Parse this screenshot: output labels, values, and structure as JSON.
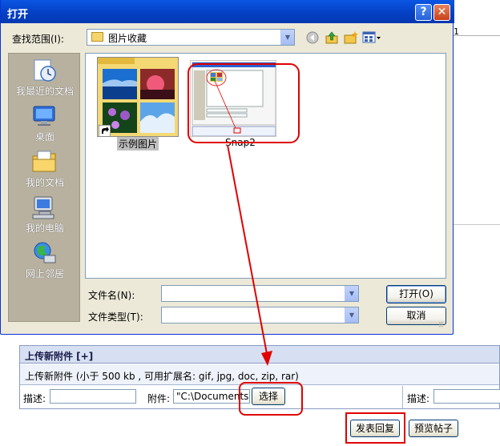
{
  "dialog": {
    "title": "打开",
    "help_glyph": "?",
    "close_glyph": "✕",
    "lookin_label": "查找范围(I):",
    "lookin_value": "图片收藏",
    "filename_label": "文件名(N):",
    "filename_value": "",
    "filetype_label": "文件类型(T):",
    "filetype_value": "",
    "open_label": "打开(O)",
    "cancel_label": "取消",
    "toolbar_icons": [
      "back-icon",
      "up-folder-icon",
      "new-folder-icon",
      "view-menu-icon"
    ],
    "places": [
      {
        "label": "我最近的文档",
        "icon": "recent-documents-icon"
      },
      {
        "label": "桌面",
        "icon": "desktop-icon"
      },
      {
        "label": "我的文档",
        "icon": "my-documents-icon"
      },
      {
        "label": "我的电脑",
        "icon": "my-computer-icon"
      },
      {
        "label": "网上邻居",
        "icon": "network-places-icon"
      }
    ],
    "files": [
      {
        "name": "示例图片",
        "icon": "folder-thumbnail-icon",
        "selected": true
      },
      {
        "name": "Snap2",
        "icon": "image-thumbnail-icon",
        "selected": false
      }
    ]
  },
  "page": {
    "background_text": "1",
    "upload": {
      "title": "上传新附件 [+]",
      "info": "上传新附件 (小于 500 kb , 可用扩展名: gif, jpg, doc, zip, rar)",
      "desc_label": "描述:",
      "desc_value": "",
      "attach_label": "附件:",
      "attach_value": "\"C:\\Documents",
      "choose_label": "选择",
      "desc2_label": "描述:"
    },
    "post_reply_label": "发表回复",
    "preview_label": "预览帖子"
  },
  "colors": {
    "titlebar": "#0542c7",
    "dialog_bg": "#ece9d8",
    "places_bg": "#b8b1a0",
    "annotation": "#e00000",
    "upload_header_bg": "#d6e0f2"
  }
}
